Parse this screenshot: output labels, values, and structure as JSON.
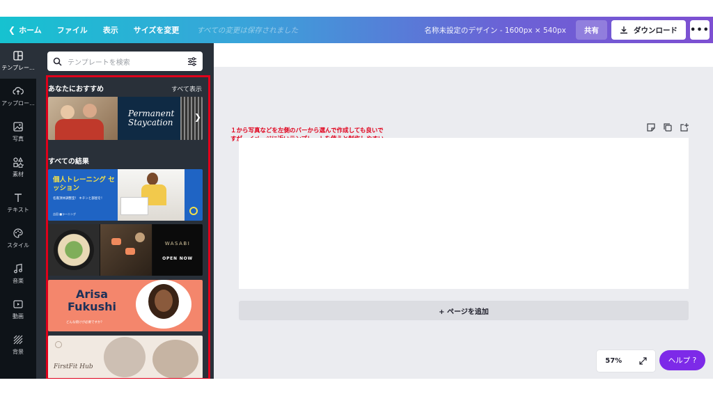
{
  "topbar": {
    "home": "ホーム",
    "file": "ファイル",
    "view": "表示",
    "resize": "サイズを変更",
    "saved_status": "すべての変更は保存されました",
    "doc_name": "名称未設定のデザイン - 1600px × 540px",
    "share": "共有",
    "download": "ダウンロード",
    "more": "•••"
  },
  "rail": {
    "items": [
      {
        "label": "テンプレー...",
        "icon": "layout-icon"
      },
      {
        "label": "アップロー...",
        "icon": "cloud-upload-icon"
      },
      {
        "label": "写真",
        "icon": "photo-icon"
      },
      {
        "label": "素材",
        "icon": "elements-icon"
      },
      {
        "label": "テキスト",
        "icon": "text-icon"
      },
      {
        "label": "スタイル",
        "icon": "palette-icon"
      },
      {
        "label": "音楽",
        "icon": "music-icon"
      },
      {
        "label": "動画",
        "icon": "video-icon"
      },
      {
        "label": "背景",
        "icon": "background-icon"
      }
    ]
  },
  "panel": {
    "search_placeholder": "テンプレートを検索",
    "recommended_title": "あなたにおすすめ",
    "see_all": "すべて表示",
    "all_results_title": "すべての結果",
    "templates": {
      "t1_line1": "Permanent",
      "t1_line2": "Staycation",
      "t2_title": "個人トレーニング セッション",
      "t2_sub": "名嘉頂体調整室！ キチンと部屋を！",
      "t2_foot": "吉田 ■ラーニング",
      "t3_brand": "WASABI",
      "t3_cta": "OPEN NOW",
      "t4_line1": "Arisa",
      "t4_line2": "Fukushi",
      "t4_sub": "どんな続けが必要ですか？",
      "t5_text": "FirstFit Hub"
    }
  },
  "canvas": {
    "annotation_line1": "１から写真などを左側のバーから選んで作成しても良いで",
    "annotation_line2": "すが、イメージに近いテンプレートを使うと制作しやすい。",
    "add_page": "+ ページを追加",
    "zoom": "57%",
    "help": "ヘルプ ?"
  },
  "colors": {
    "accent_red": "#e0001b",
    "help_purple": "#7d2ae8",
    "panel_bg": "#293039",
    "rail_bg": "#0e1318"
  }
}
